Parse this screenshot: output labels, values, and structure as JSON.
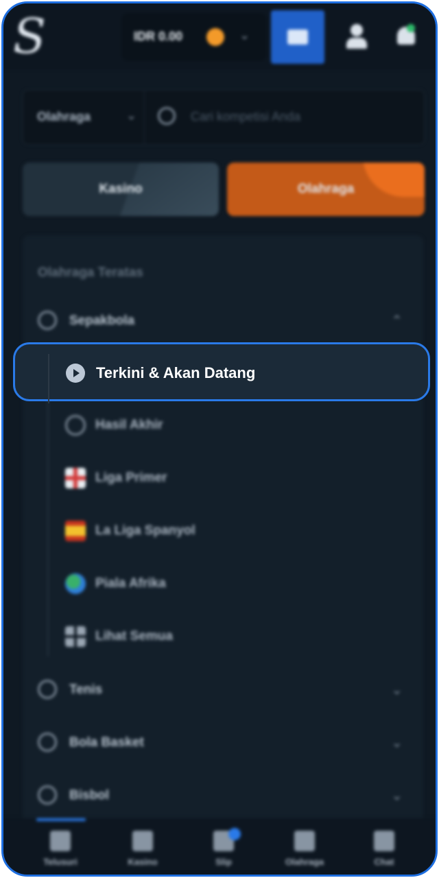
{
  "colors": {
    "accent_blue": "#2a7ae8",
    "sports_tab_orange": "#c45a18",
    "background": "#0f1923",
    "panel": "#131f2a"
  },
  "header": {
    "logo_letter": "S",
    "balance": "IDR 0.00",
    "balance_icon": "coin-icon",
    "wallet_icon": "wallet-icon",
    "user_icon": "user-icon",
    "notification_icon": "bell-icon"
  },
  "search": {
    "sport_select": "Olahraga",
    "placeholder": "Cari kompetisi Anda"
  },
  "tabs": [
    {
      "label": "Kasino",
      "active": false
    },
    {
      "label": "Olahraga",
      "active": true
    }
  ],
  "sports": {
    "section_title": "Olahraga Teratas",
    "football": {
      "label": "Sepakbola",
      "expanded": true,
      "items": [
        {
          "label": "Terkini & Akan Datang",
          "icon": "play-icon",
          "selected": true
        },
        {
          "label": "Hasil Akhir",
          "icon": "clock-icon"
        },
        {
          "label": "Liga Primer",
          "icon": "flag-england-icon"
        },
        {
          "label": "La Liga Spanyol",
          "icon": "flag-spain-icon"
        },
        {
          "label": "Piala Afrika",
          "icon": "globe-africa-icon"
        },
        {
          "label": "Lihat Semua",
          "icon": "grid-icon"
        }
      ]
    },
    "others": [
      {
        "label": "Tenis",
        "icon": "tennis-ball-icon"
      },
      {
        "label": "Bola Basket",
        "icon": "basketball-icon"
      },
      {
        "label": "Bisbol",
        "icon": "baseball-icon"
      }
    ]
  },
  "bottom_nav": [
    {
      "label": "Telusuri",
      "icon": "browse-icon"
    },
    {
      "label": "Kasino",
      "icon": "diamond-icon"
    },
    {
      "label": "Slip",
      "icon": "betslip-icon"
    },
    {
      "label": "Olahraga",
      "icon": "sports-icon"
    },
    {
      "label": "Chat",
      "icon": "chat-icon"
    }
  ]
}
